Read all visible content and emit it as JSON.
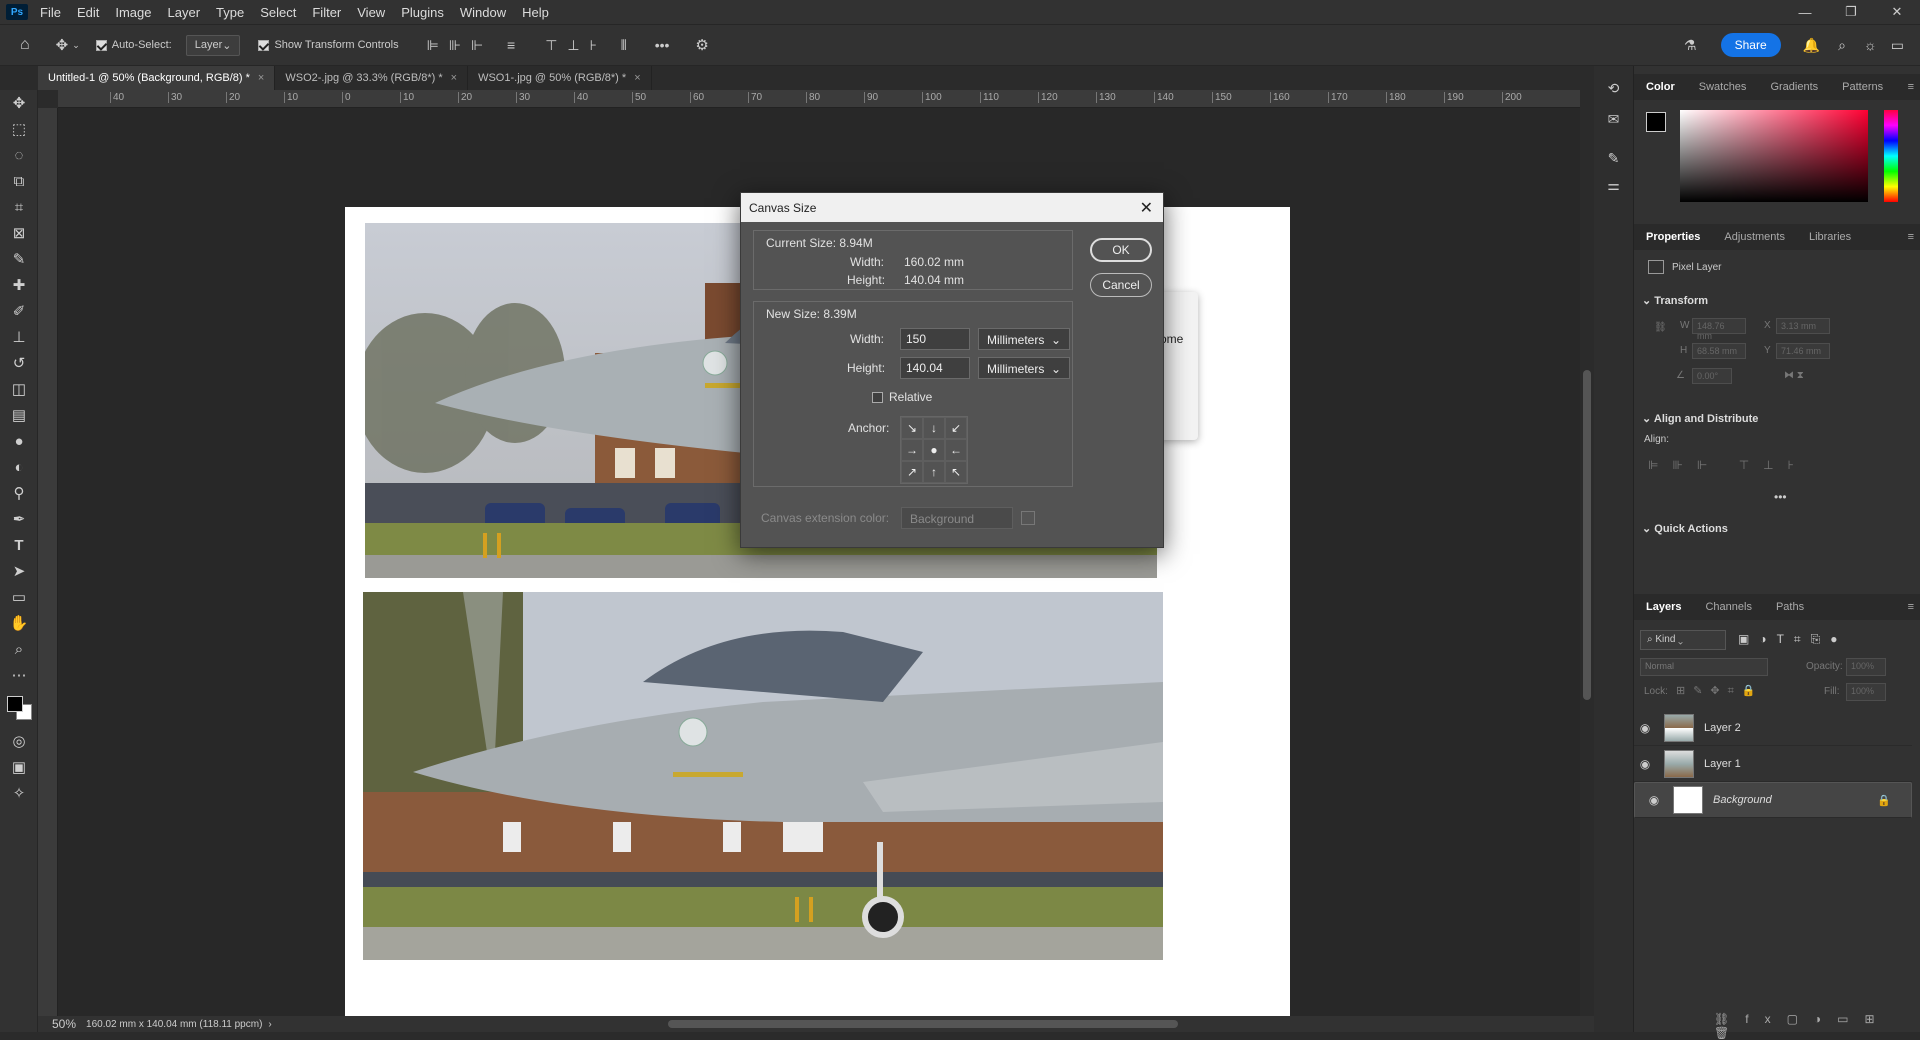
{
  "app": {
    "logo": "Ps"
  },
  "menu": [
    "File",
    "Edit",
    "Image",
    "Layer",
    "Type",
    "Select",
    "Filter",
    "View",
    "Plugins",
    "Window",
    "Help"
  ],
  "options": {
    "auto_select": "Auto-Select:",
    "auto_select_value": "Layer",
    "show_transform": "Show Transform Controls",
    "more": "•••",
    "share": "Share"
  },
  "tabs": [
    {
      "label": "Untitled-1 @ 50% (Background, RGB/8) *",
      "x": "×"
    },
    {
      "label": "WSO2-.jpg @ 33.3% (RGB/8*) *",
      "x": "×"
    },
    {
      "label": "WSO1-.jpg @ 50% (RGB/8*) *",
      "x": "×"
    }
  ],
  "ruler_ticks": [
    "40",
    "30",
    "20",
    "10",
    "0",
    "10",
    "20",
    "30",
    "40",
    "50",
    "60",
    "70",
    "80",
    "90",
    "100",
    "110",
    "120",
    "130",
    "140",
    "150",
    "160",
    "170",
    "180",
    "190",
    "200"
  ],
  "status": {
    "zoom": "50%",
    "info": "160.02 mm x 140.04 mm (118.11 ppcm)"
  },
  "dialog": {
    "title": "Canvas Size",
    "current_size": "Current Size: 8.94M",
    "width_label": "Width:",
    "height_label": "Height:",
    "current_width": "160.02 mm",
    "current_height": "140.04 mm",
    "new_size": "New Size: 8.39M",
    "new_width": "150",
    "new_height": "140.04",
    "unit": "Millimeters",
    "relative": "Relative",
    "anchor": "Anchor:",
    "anchor_glyphs": [
      "↘",
      "↓",
      "↙",
      "→",
      "●",
      "←",
      "↗",
      "↑",
      "↖"
    ],
    "ext_color_label": "Canvas extension color:",
    "ext_color_value": "Background",
    "ok": "OK",
    "cancel": "Cancel"
  },
  "behind_dialog_fragment": "ome",
  "color_panel": {
    "tabs": [
      "Color",
      "Swatches",
      "Gradients",
      "Patterns"
    ]
  },
  "properties": {
    "tabs": [
      "Properties",
      "Adjustments",
      "Libraries"
    ],
    "kind": "Pixel Layer",
    "transform": "Transform",
    "w": "W",
    "w_val": "148.76 mm",
    "x": "X",
    "x_val": "3.13 mm",
    "h": "H",
    "h_val": "68.58 mm",
    "y": "Y",
    "y_val": "71.46 mm",
    "angle": "0.00°",
    "align": "Align and Distribute",
    "align_label": "Align:",
    "more": "•••",
    "quick": "Quick Actions"
  },
  "layers": {
    "tabs": [
      "Layers",
      "Channels",
      "Paths"
    ],
    "kind": "Kind",
    "blend": "Normal",
    "opacity_label": "Opacity:",
    "opacity": "100%",
    "lock_label": "Lock:",
    "fill_label": "Fill:",
    "fill": "100%",
    "items": [
      "Layer 2",
      "Layer 1",
      "Background"
    ]
  }
}
